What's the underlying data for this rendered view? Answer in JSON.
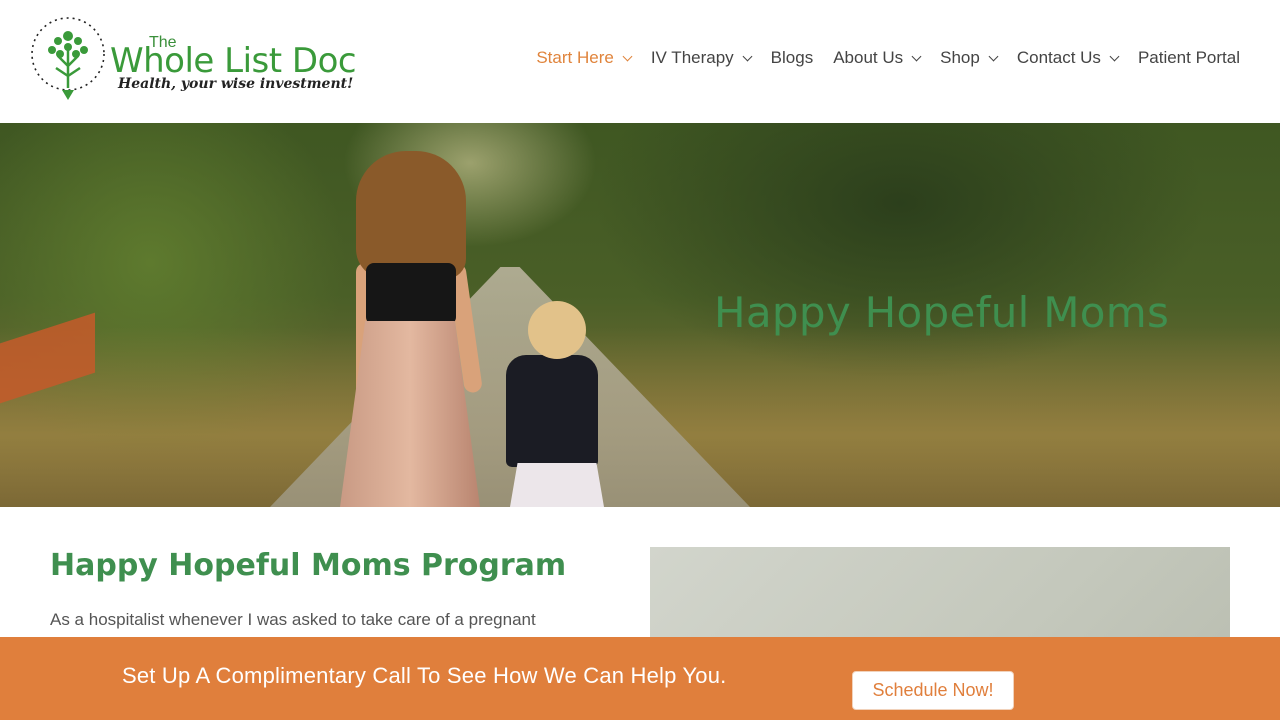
{
  "site": {
    "logo_the": "The",
    "logo_name": "Whole List Doc",
    "logo_tagline": "Health, your wise investment!"
  },
  "nav": {
    "items": [
      {
        "label": "Start Here",
        "has_dropdown": true,
        "active": true
      },
      {
        "label": "IV Therapy",
        "has_dropdown": true,
        "active": false
      },
      {
        "label": "Blogs",
        "has_dropdown": false,
        "active": false
      },
      {
        "label": "About Us",
        "has_dropdown": true,
        "active": false
      },
      {
        "label": "Shop",
        "has_dropdown": true,
        "active": false
      },
      {
        "label": "Contact Us",
        "has_dropdown": true,
        "active": false
      },
      {
        "label": "Patient Portal",
        "has_dropdown": false,
        "active": false
      }
    ]
  },
  "hero": {
    "title": "Happy Hopeful Moms"
  },
  "content": {
    "title": "Happy Hopeful Moms Program",
    "paragraph": "As a hospitalist whenever I was asked to take care of a pregnant"
  },
  "cta": {
    "text": "Set Up A Complimentary Call To See How We Can Help You.",
    "button_label": "Schedule Now!"
  },
  "colors": {
    "brand_green": "#3f8f4f",
    "accent_orange": "#e07f3c",
    "nav_active": "#e0843c"
  }
}
